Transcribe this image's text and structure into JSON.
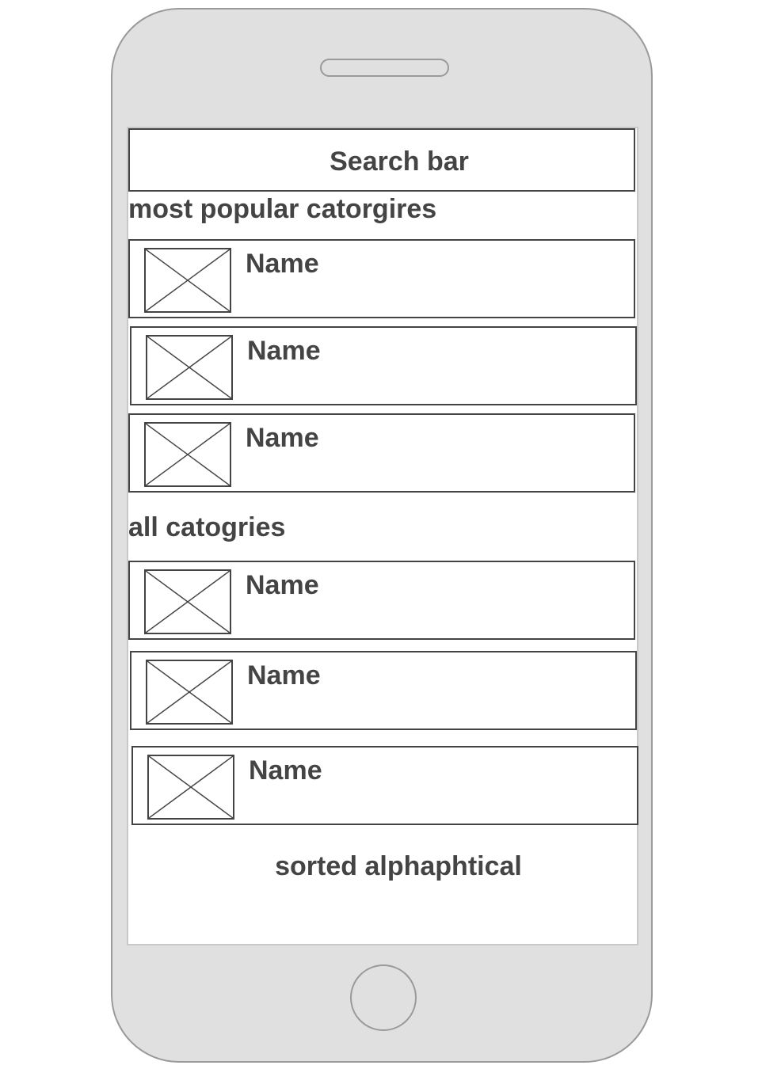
{
  "search": {
    "label": "Search bar"
  },
  "popular": {
    "heading": "most popular catorgires",
    "items": [
      {
        "name": "Name",
        "icon": "image-placeholder-icon"
      },
      {
        "name": "Name",
        "icon": "image-placeholder-icon"
      },
      {
        "name": "Name",
        "icon": "image-placeholder-icon"
      }
    ]
  },
  "all": {
    "heading": "all catogries",
    "items": [
      {
        "name": "Name",
        "icon": "image-placeholder-icon"
      },
      {
        "name": "Name",
        "icon": "image-placeholder-icon"
      },
      {
        "name": "Name",
        "icon": "image-placeholder-icon"
      }
    ],
    "note": "sorted alphaphtical"
  },
  "colors": {
    "phone_body": "#e0e0e0",
    "phone_outline": "#9a9a9a",
    "ink": "#444444",
    "screen": "#ffffff"
  }
}
